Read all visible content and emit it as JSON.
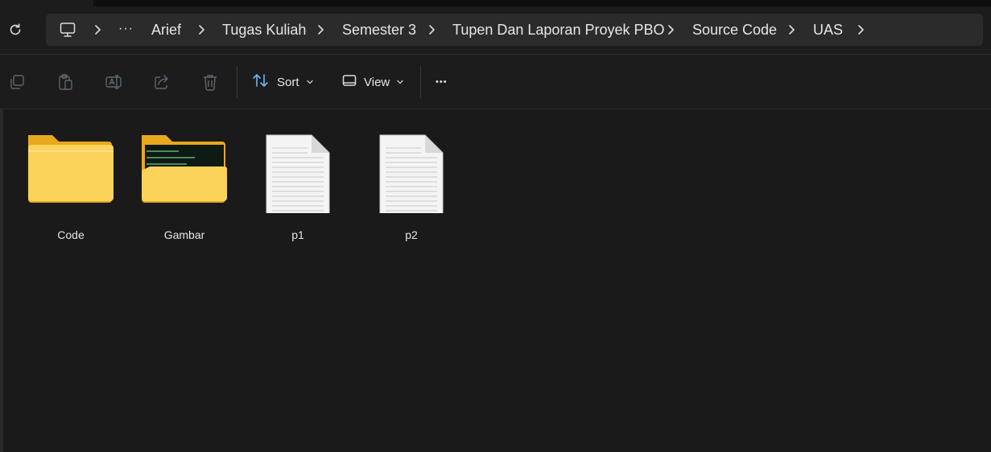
{
  "address": {
    "breadcrumbs": [
      "Arief",
      "Tugas Kuliah",
      "Semester 3",
      "Tupen Dan Laporan Proyek PBO",
      "Source Code",
      "UAS"
    ],
    "overflow_label": "···"
  },
  "toolbar": {
    "sort_label": "Sort",
    "view_label": "View",
    "more_label": "•••"
  },
  "files": [
    {
      "name": "Code",
      "type": "folder"
    },
    {
      "name": "Gambar",
      "type": "folder-with-preview"
    },
    {
      "name": "p1",
      "type": "text-file"
    },
    {
      "name": "p2",
      "type": "text-file"
    }
  ],
  "colors": {
    "background": "#1c1c1c",
    "address_bar": "#2b2b2b",
    "folder": "#f8c94a",
    "accent_sort": "#6fb6f0"
  }
}
